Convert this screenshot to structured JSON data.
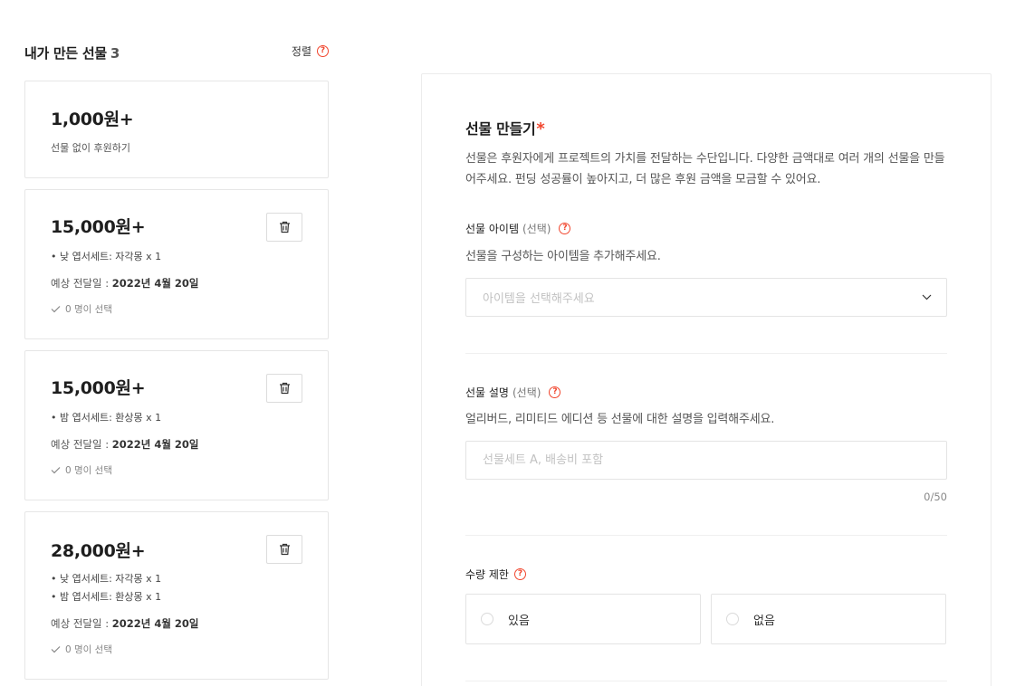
{
  "left": {
    "title": "내가 만든 선물",
    "count": "3",
    "sort_label": "정렬",
    "help_glyph": "?"
  },
  "cards": [
    {
      "price": "1,000원+",
      "sub": "선물 없이 후원하기"
    },
    {
      "price": "15,000원+",
      "items": [
        "• 낮 엽서세트: 자각몽 x 1"
      ],
      "delivery_label": "예상 전달일 : ",
      "delivery_date": "2022년 4월 20일",
      "selected": "0 명이 선택"
    },
    {
      "price": "15,000원+",
      "items": [
        "• 밤 엽서세트: 환상몽 x 1"
      ],
      "delivery_label": "예상 전달일 : ",
      "delivery_date": "2022년 4월 20일",
      "selected": "0 명이 선택"
    },
    {
      "price": "28,000원+",
      "items": [
        "• 낮 엽서세트: 자각몽 x 1",
        "• 밤 엽서세트: 환상몽 x 1"
      ],
      "delivery_label": "예상 전달일 : ",
      "delivery_date": "2022년 4월 20일",
      "selected": "0 명이 선택"
    }
  ],
  "panel": {
    "title": "선물 만들기",
    "required_mark": "*",
    "description": "선물은 후원자에게 프로젝트의 가치를 전달하는 수단입니다. 다양한 금액대로 여러 개의 선물을 만들어주세요. 펀딩 성공률이 높아지고, 더 많은 후원 금액을 모금할 수 있어요.",
    "item_field": {
      "label": "선물 아이템",
      "optional": "(선택)",
      "hint": "선물을 구성하는 아이템을 추가해주세요.",
      "placeholder": "아이템을 선택해주세요"
    },
    "desc_field": {
      "label": "선물 설명",
      "optional": "(선택)",
      "hint": "얼리버드, 리미티드 에디션 등 선물에 대한 설명을 입력해주세요.",
      "placeholder": "선물세트 A, 배송비 포함",
      "counter": "0/50"
    },
    "limit_field": {
      "label": "수량 제한",
      "options": [
        "있음",
        "없음"
      ]
    }
  },
  "colors": {
    "accent": "#f1462e",
    "border": "#e6e6e6",
    "text_dark": "#1e1e1e"
  },
  "icons": {
    "help": "question-circle-icon",
    "trash": "trash-icon",
    "check": "check-icon",
    "chevron": "chevron-down-icon"
  }
}
